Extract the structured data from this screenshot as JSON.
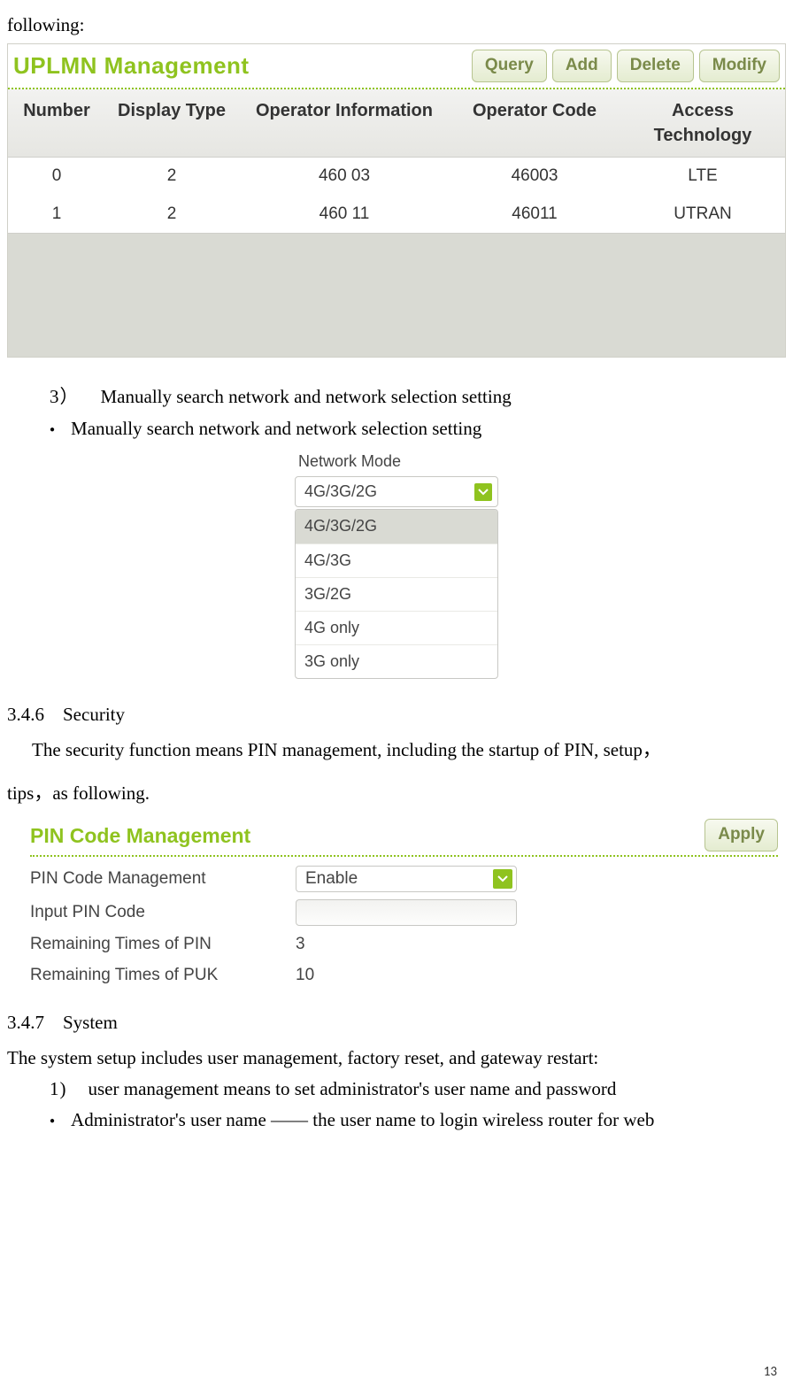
{
  "doc": {
    "following": "following:",
    "item3_num": "3）",
    "item3_text": "Manually search network and network selection setting",
    "bullet3_text": "Manually search network and network selection setting",
    "sec346_num": "3.4.6",
    "sec346_title": "Security",
    "sec346_body1": "The security function means PIN management, including the startup of PIN, setup，",
    "sec346_body2": "tips，as following.",
    "sec347_num": "3.4.7",
    "sec347_title": "System",
    "sec347_body": "The system setup includes user management, factory reset, and gateway restart:",
    "item347_1_num": "1)",
    "item347_1_text": "user management means to set administrator's user name and password",
    "bullet347_text": "Administrator's user name —— the user name to login wireless router for web",
    "page_number": "13"
  },
  "uplmn": {
    "title": "UPLMN Management",
    "buttons": {
      "query": "Query",
      "add": "Add",
      "delete": "Delete",
      "modify": "Modify"
    },
    "headers": {
      "number": "Number",
      "display_type": "Display Type",
      "operator_info": "Operator Information",
      "operator_code": "Operator Code",
      "access_tech": "Access Technology"
    },
    "rows": [
      {
        "number": "0",
        "display_type": "2",
        "operator_info": "460 03",
        "operator_code": "46003",
        "access_tech": "LTE"
      },
      {
        "number": "1",
        "display_type": "2",
        "operator_info": "460 11",
        "operator_code": "46011",
        "access_tech": "UTRAN"
      }
    ]
  },
  "netmode": {
    "label": "Network Mode",
    "selected": "4G/3G/2G",
    "options": [
      "4G/3G/2G",
      "4G/3G",
      "3G/2G",
      "4G only",
      "3G only"
    ]
  },
  "pin": {
    "title": "PIN Code Management",
    "apply": "Apply",
    "rows": {
      "mgmt_label": "PIN Code Management",
      "mgmt_value": "Enable",
      "input_label": "Input PIN Code",
      "pin_label": "Remaining Times of PIN",
      "pin_value": "3",
      "puk_label": "Remaining Times of PUK",
      "puk_value": "10"
    }
  }
}
